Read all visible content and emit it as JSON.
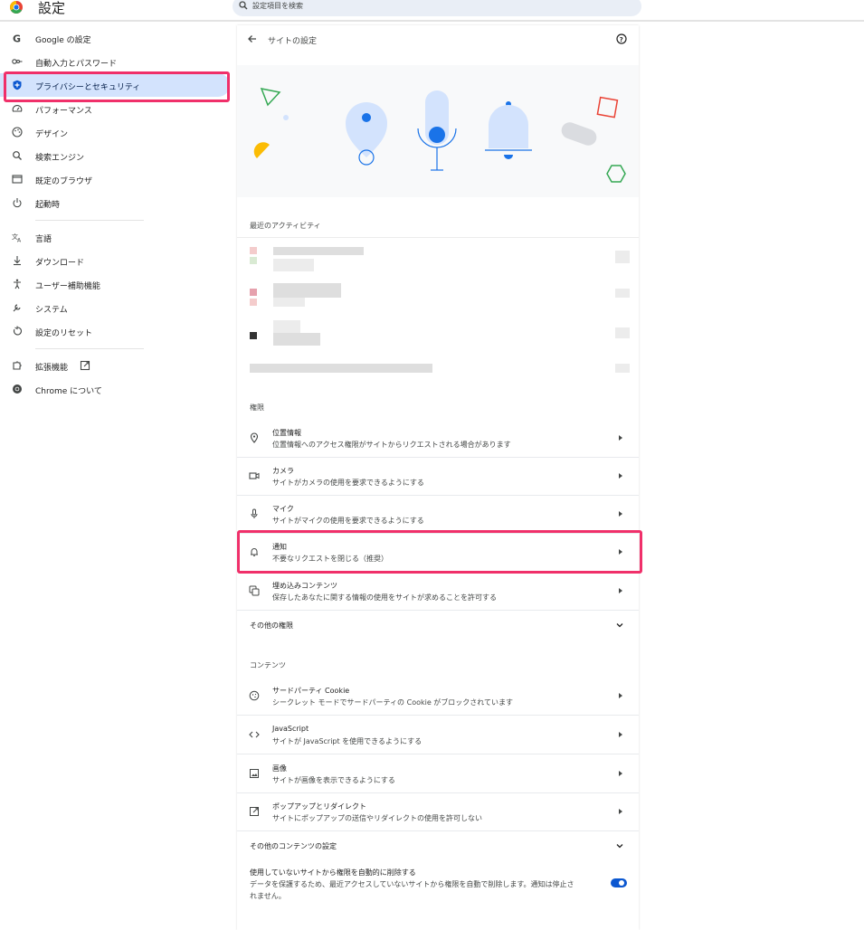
{
  "header": {
    "app_title": "設定",
    "search_placeholder": "設定項目を検索"
  },
  "sidebar": {
    "items": [
      {
        "label": "Google の設定",
        "icon": "google-g-icon"
      },
      {
        "label": "自動入力とパスワード",
        "icon": "key-icon"
      },
      {
        "label": "プライバシーとセキュリティ",
        "icon": "shield-icon",
        "active": true
      },
      {
        "label": "パフォーマンス",
        "icon": "speedometer-icon"
      },
      {
        "label": "デザイン",
        "icon": "palette-icon"
      },
      {
        "label": "検索エンジン",
        "icon": "search-icon"
      },
      {
        "label": "既定のブラウザ",
        "icon": "browser-window-icon"
      },
      {
        "label": "起動時",
        "icon": "power-icon"
      },
      {
        "label": "言語",
        "icon": "translate-icon"
      },
      {
        "label": "ダウンロード",
        "icon": "download-icon"
      },
      {
        "label": "ユーザー補助機能",
        "icon": "accessibility-icon"
      },
      {
        "label": "システム",
        "icon": "wrench-icon"
      },
      {
        "label": "設定のリセット",
        "icon": "reset-icon"
      },
      {
        "label": "拡張機能",
        "icon": "puzzle-icon"
      },
      {
        "label": "Chrome について",
        "icon": "chrome-icon"
      }
    ],
    "active_color": "#d3e3fd"
  },
  "page": {
    "title": "サイトの設定",
    "recent_activity_title": "最近のアクティビティ",
    "permissions_title": "権限",
    "permissions": [
      {
        "title": "位置情報",
        "sub": "位置情報へのアクセス権限がサイトからリクエストされる場合があります",
        "icon": "location-pin-icon"
      },
      {
        "title": "カメラ",
        "sub": "サイトがカメラの使用を要求できるようにする",
        "icon": "camera-icon"
      },
      {
        "title": "マイク",
        "sub": "サイトがマイクの使用を要求できるようにする",
        "icon": "microphone-icon"
      },
      {
        "title": "通知",
        "sub": "不要なリクエストを閉じる（推奨）",
        "icon": "bell-icon"
      },
      {
        "title": "埋め込みコンテンツ",
        "sub": "保存したあなたに関する情報の使用をサイトが求めることを許可する",
        "icon": "embedded-content-icon"
      }
    ],
    "more_permissions": "その他の権限",
    "content_title": "コンテンツ",
    "content": [
      {
        "title": "サードパーティ Cookie",
        "sub": "シークレット モードでサードパーティの Cookie がブロックされています",
        "icon": "cookie-icon"
      },
      {
        "title": "JavaScript",
        "sub": "サイトが JavaScript を使用できるようにする",
        "icon": "code-icon"
      },
      {
        "title": "画像",
        "sub": "サイトが画像を表示できるようにする",
        "icon": "image-icon"
      },
      {
        "title": "ポップアップとリダイレクト",
        "sub": "サイトにポップアップの送信やリダイレクトの使用を許可しない",
        "icon": "open-external-icon"
      }
    ],
    "more_content": "その他のコンテンツの設定",
    "auto_remove": {
      "title": "使用していないサイトから権限を自動的に削除する",
      "sub1": "データを保護するため、最近アクセスしていないサイトから権限を自動で削除します。通知は停止さ",
      "sub2": "れません。",
      "enabled": true
    }
  },
  "colors": {
    "highlight": "#f0306a",
    "accent": "#0b57d0"
  }
}
